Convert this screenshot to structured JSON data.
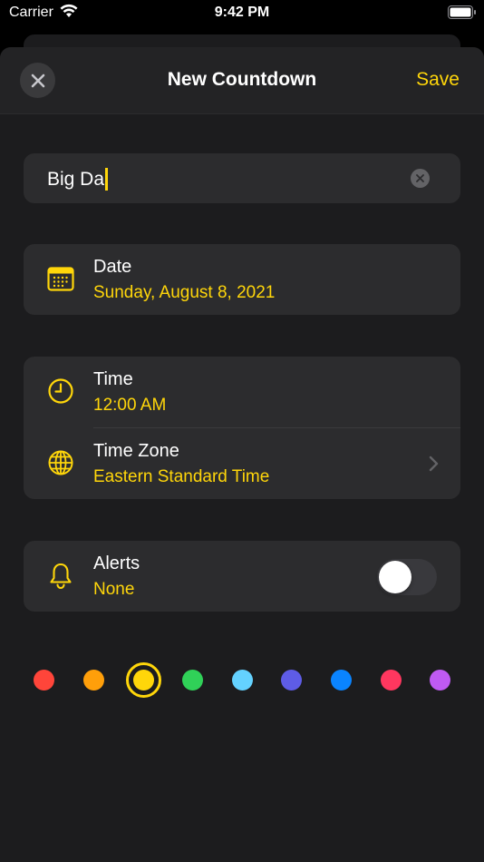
{
  "status": {
    "carrier": "Carrier",
    "time": "9:42 PM"
  },
  "nav": {
    "title": "New Countdown",
    "save_label": "Save"
  },
  "name_field": {
    "value": "Big Da"
  },
  "date": {
    "label": "Date",
    "value": "Sunday, August 8, 2021"
  },
  "time": {
    "label": "Time",
    "value": "12:00 AM"
  },
  "timezone": {
    "label": "Time Zone",
    "value": "Eastern Standard Time"
  },
  "alerts": {
    "label": "Alerts",
    "value": "None",
    "enabled": false
  },
  "colors": {
    "accent": "#ffd60a",
    "options": [
      {
        "name": "red",
        "hex": "#ff453a"
      },
      {
        "name": "orange",
        "hex": "#ff9f0a"
      },
      {
        "name": "yellow",
        "hex": "#ffd60a",
        "selected": true
      },
      {
        "name": "green",
        "hex": "#30d158"
      },
      {
        "name": "cyan",
        "hex": "#64d2ff"
      },
      {
        "name": "indigo",
        "hex": "#5e5ce6"
      },
      {
        "name": "blue",
        "hex": "#0a84ff"
      },
      {
        "name": "pink",
        "hex": "#ff375f"
      },
      {
        "name": "purple",
        "hex": "#bf5af2"
      }
    ]
  }
}
